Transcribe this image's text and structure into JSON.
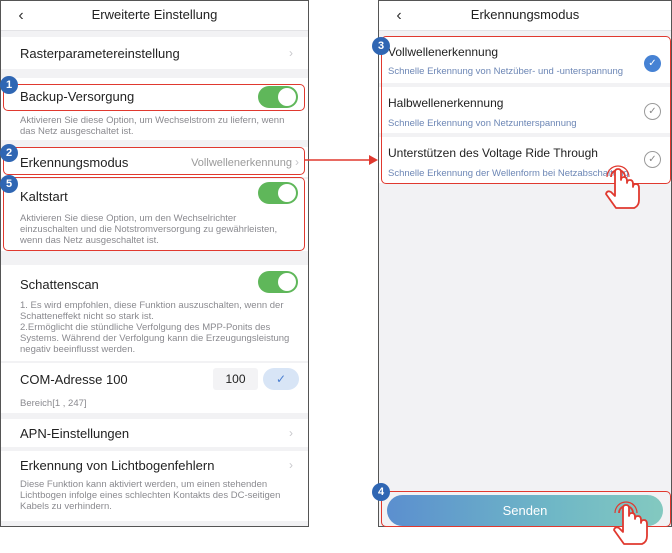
{
  "left": {
    "title": "Erweiterte Einstellung",
    "grid": {
      "label": "Rasterparametereinstellung"
    },
    "backup": {
      "label": "Backup-Versorgung",
      "enabled": true,
      "desc": "Aktivieren Sie diese Option, um Wechselstrom zu liefern, wenn das Netz ausgeschaltet ist."
    },
    "detection": {
      "label": "Erkennungsmodus",
      "value": "Vollwellenerkennung"
    },
    "coldstart": {
      "label": "Kaltstart",
      "enabled": true,
      "desc": "Aktivieren Sie diese Option, um den Wechselrichter einzuschalten und die Notstromversorgung zu gewährleisten, wenn das Netz ausgeschaltet ist."
    },
    "shadow": {
      "label": "Schattenscan",
      "enabled": true,
      "desc": "1. Es wird empfohlen, diese Funktion auszuschalten, wenn der Schatteneffekt nicht so stark ist.\n2.Ermöglicht die stündliche Verfolgung des MPP-Ponits des Systems. Während der Verfolgung kann die Erzeugungsleistung negativ beeinflusst werden."
    },
    "com": {
      "label": "COM-Adresse 100",
      "value": "100",
      "range": "Bereich[1 , 247]"
    },
    "apn": {
      "label": "APN-Einstellungen"
    },
    "arc": {
      "label": "Erkennung von Lichtbogenfehlern",
      "desc": "Diese Funktion kann aktiviert werden, um einen stehenden Lichtbogen infolge eines schlechten Kontakts des DC-seitigen Kabels zu verhindern."
    }
  },
  "right": {
    "title": "Erkennungsmodus",
    "options": [
      {
        "title": "Vollwellenerkennung",
        "sub": "Schnelle Erkennung von Netzüber- und -unterspannung",
        "selected": true
      },
      {
        "title": "Halbwellenerkennung",
        "sub": "Schnelle Erkennung von Netzunterspannung",
        "selected": false
      },
      {
        "title": "Unterstützen des Voltage Ride Through",
        "sub": "Schnelle Erkennung der Wellenform bei Netzabschaltung",
        "selected": false
      }
    ],
    "send_label": "Senden"
  },
  "badges": [
    "1",
    "2",
    "3",
    "4",
    "5"
  ],
  "icons": {
    "back": "‹",
    "chevron": "›",
    "check": "✓"
  },
  "colors": {
    "highlight": "#e0392f",
    "badge": "#2f66b3",
    "toggle_on": "#5fb75a",
    "accent": "#4682d4"
  }
}
